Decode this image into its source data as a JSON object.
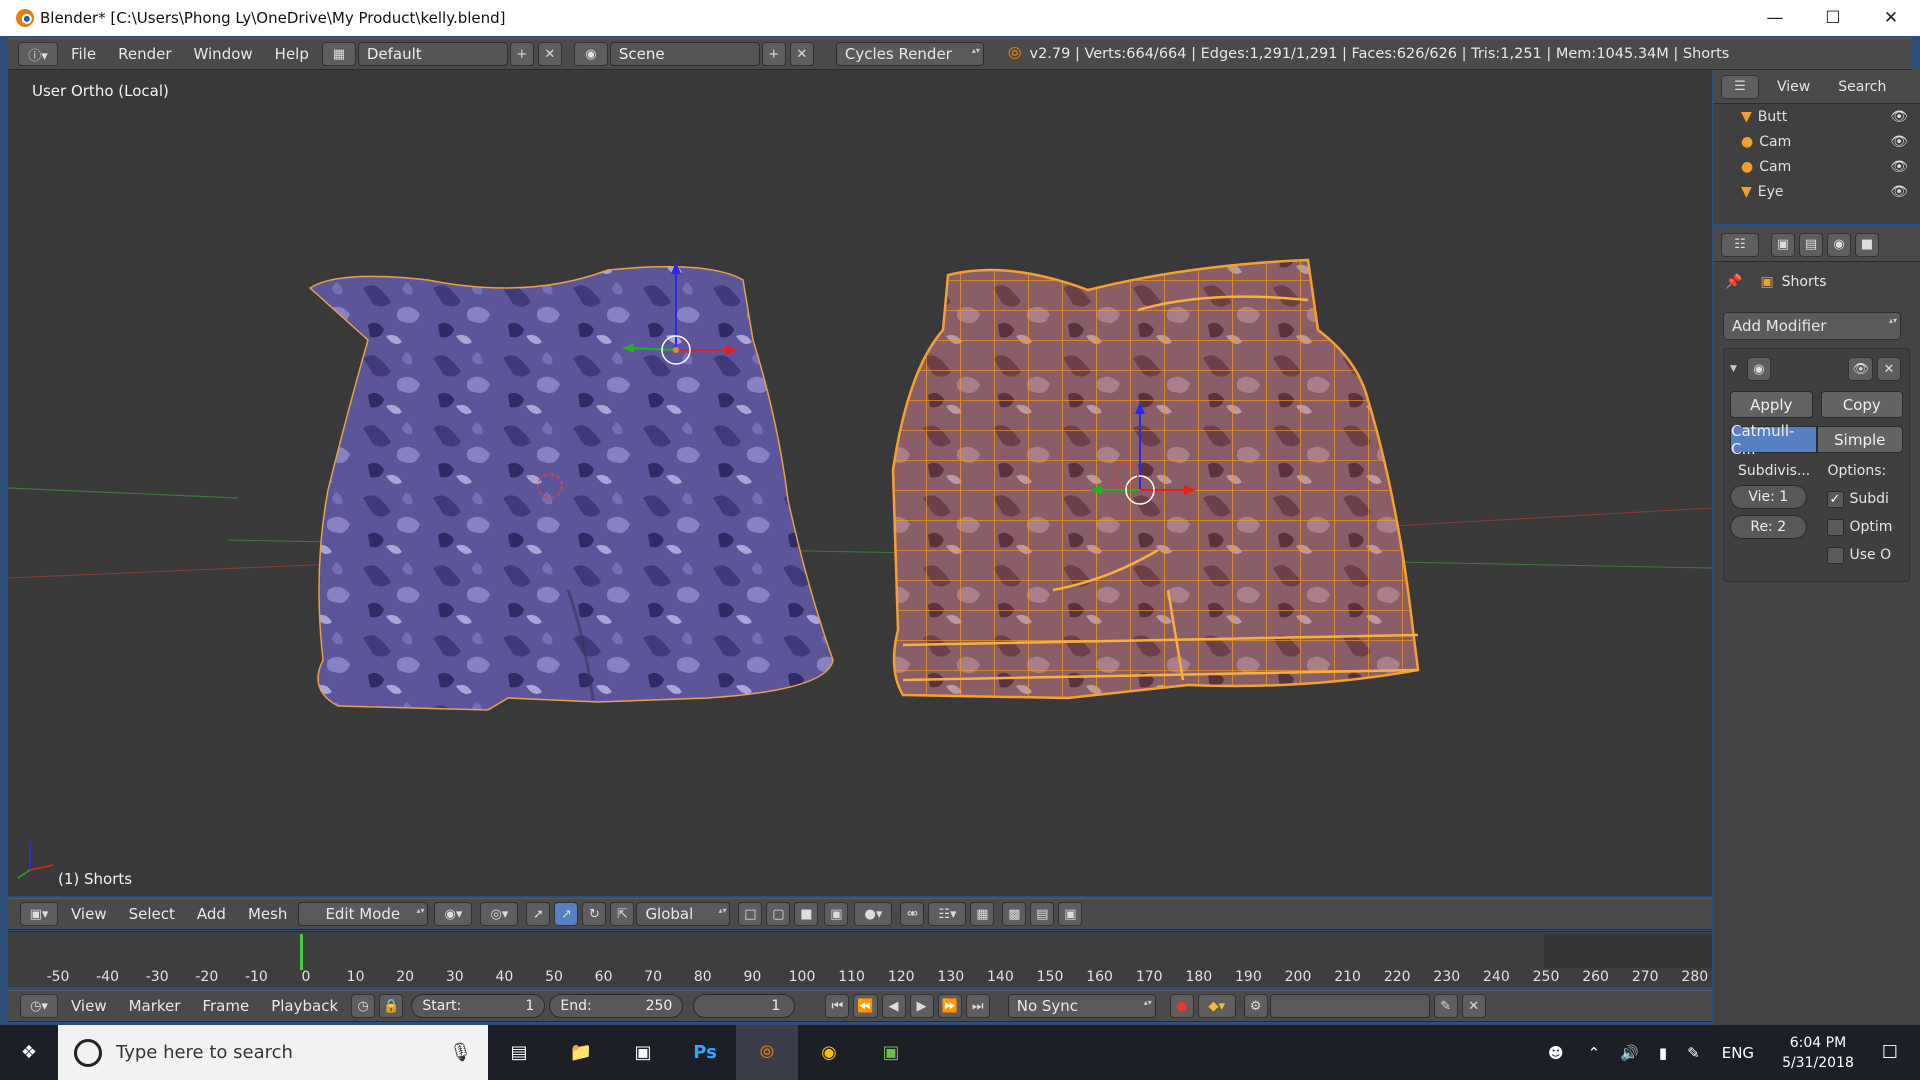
{
  "window": {
    "title": "Blender* [C:\\Users\\Phong Ly\\OneDrive\\My Product\\kelly.blend]",
    "minimize": "—",
    "maximize": "☐",
    "close": "✕"
  },
  "menubar": {
    "menus": [
      "File",
      "Render",
      "Window",
      "Help"
    ],
    "layout": "Default",
    "scene": "Scene",
    "engine": "Cycles Render",
    "stats": "v2.79 | Verts:664/664 | Edges:1,291/1,291 | Faces:626/626 | Tris:1,251 | Mem:1045.34M | Shorts"
  },
  "viewport": {
    "view_label": "User Ortho (Local)",
    "object_label": "(1) Shorts"
  },
  "outliner": {
    "header_items": [
      "View",
      "Search"
    ],
    "objects": [
      {
        "name": "Butt",
        "icon": "mesh-icon"
      },
      {
        "name": "Cam",
        "icon": "armature-icon"
      },
      {
        "name": "Cam",
        "icon": "armature-icon"
      },
      {
        "name": "Eye",
        "icon": "mesh-icon"
      }
    ]
  },
  "properties": {
    "breadcrumb": "Shorts",
    "add_modifier": "Add Modifier",
    "apply": "Apply",
    "copy": "Copy",
    "tab_catmull": "Catmull-C...",
    "tab_simple": "Simple",
    "subdivisions_label": "Subdivis...",
    "options_label": "Options:",
    "view_levels": "Vie: 1",
    "render_levels": "Re: 2",
    "options": [
      {
        "label": "Subdi",
        "checked": true
      },
      {
        "label": "Optim",
        "checked": false
      },
      {
        "label": "Use O",
        "checked": false
      }
    ]
  },
  "view3d_header": {
    "menus": [
      "View",
      "Select",
      "Add",
      "Mesh"
    ],
    "mode": "Edit Mode",
    "orientation": "Global"
  },
  "timeline": {
    "ticks": [
      "-50",
      "-40",
      "-30",
      "-20",
      "-10",
      "0",
      "10",
      "20",
      "30",
      "40",
      "50",
      "60",
      "70",
      "80",
      "90",
      "100",
      "110",
      "120",
      "130",
      "140",
      "150",
      "160",
      "170",
      "180",
      "190",
      "200",
      "210",
      "220",
      "230",
      "240",
      "250",
      "260",
      "270",
      "280"
    ],
    "menus": [
      "View",
      "Marker",
      "Frame",
      "Playback"
    ],
    "start": "Start:",
    "start_value": "1",
    "end": "End:",
    "end_value": "250",
    "current_frame": "1",
    "sync": "No Sync"
  },
  "taskbar": {
    "search_placeholder": "Type here to search",
    "time": "6:04 PM",
    "date": "5/31/2018",
    "language": "ENG"
  },
  "colors": {
    "accent_blue": "#5680c2",
    "selection_orange": "#f0a030",
    "viewport_bg": "#393939"
  }
}
